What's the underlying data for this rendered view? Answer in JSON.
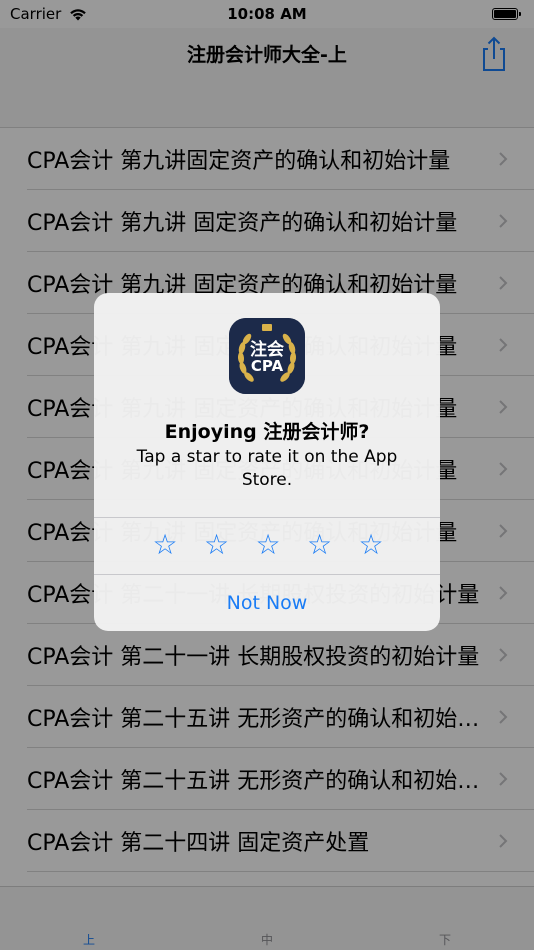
{
  "status_bar": {
    "carrier": "Carrier",
    "time": "10:08 AM"
  },
  "nav": {
    "title": "注册会计师大全-上"
  },
  "list_items": [
    "CPA会计 第九讲固定资产的确认和初始计量",
    "CPA会计 第九讲 固定资产的确认和初始计量",
    "CPA会计 第九讲 固定资产的确认和初始计量",
    "CPA会计 第九讲 固定资产的确认和初始计量",
    "CPA会计 第九讲 固定资产的确认和初始计量",
    "CPA会计 第九讲 固定资产的确认和初始计量",
    "CPA会计 第九讲 固定资产的确认和初始计量",
    "CPA会计 第二十一讲 长期股权投资的初始计量",
    "CPA会计 第二十一讲 长期股权投资的初始计量",
    "CPA会计 第二十五讲 无形资产的确认和初始计量",
    "CPA会计 第二十五讲 无形资产的确认和初始计量",
    "CPA会计 第二十四讲 固定资产处置"
  ],
  "tabs": [
    "上",
    "中",
    "下"
  ],
  "alert": {
    "icon_text_top": "注会",
    "icon_text_bottom": "CPA",
    "title": "Enjoying 注册会计师?",
    "message": "Tap a star to rate it on the App Store.",
    "star_glyph": "☆",
    "star_count": 5,
    "not_now": "Not Now"
  },
  "colors": {
    "accent": "#1a7cf5",
    "icon_bg": "#1c2a4a",
    "icon_gold": "#d9b24a"
  }
}
